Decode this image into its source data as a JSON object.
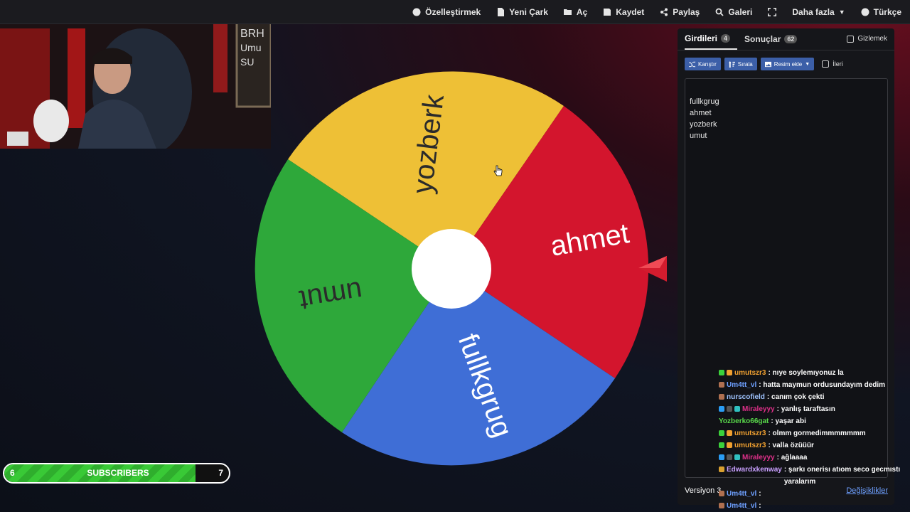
{
  "nav": {
    "customize": "Özelleştirmek",
    "new_wheel": "Yeni Çark",
    "open": "Aç",
    "save": "Kaydet",
    "share": "Paylaş",
    "gallery": "Galeri",
    "more": "Daha fazla",
    "language": "Türkçe"
  },
  "wheel": {
    "segments": [
      {
        "label": "yozberk",
        "color": "#eec036"
      },
      {
        "label": "ahmet",
        "color": "#d3152d"
      },
      {
        "label": "fullkgrug",
        "color": "#3f6ed6"
      },
      {
        "label": "umut",
        "color": "#2ea83a"
      }
    ]
  },
  "panel": {
    "tab_entries": "Girdileri",
    "entries_count": "4",
    "tab_results": "Sonuçlar",
    "results_count": "62",
    "hide": "Gizlemek",
    "shuffle": "Karıştır",
    "sort": "Sırala",
    "add_image": "Resim ekle",
    "advanced": "İleri",
    "entries": [
      "fullkgrug",
      "ahmet",
      "yozberk",
      "umut"
    ],
    "version": "Versiyon 3",
    "changes": "Değişiklikler"
  },
  "chat": [
    {
      "user": "umutszr3",
      "color": "#f0a030",
      "msg": ": nıye soylemıyonuz la",
      "badges": [
        "#3bd13b",
        "#f0a030"
      ]
    },
    {
      "user": "Um4tt_vl",
      "color": "#6ea0ff",
      "msg": ": hatta maymun ordusundayım dedim",
      "badges": [
        "#b07050"
      ]
    },
    {
      "user": "nurscofield",
      "color": "#a0c4ff",
      "msg": ": canım çok çekti",
      "badges": [
        "#b07050"
      ]
    },
    {
      "user": "Miraleyyy",
      "color": "#e0308a",
      "msg": ": yanlış taraftasın",
      "badges": [
        "#2a9df4",
        "#555",
        "#30c0c0"
      ]
    },
    {
      "user": "Yozberko66gat",
      "color": "#59d94b",
      "msg": ": yaşar abi",
      "badges": []
    },
    {
      "user": "umutszr3",
      "color": "#f0a030",
      "msg": ": olmm gormedimmmmmmm",
      "badges": [
        "#3bd13b",
        "#f0a030"
      ]
    },
    {
      "user": "umutszr3",
      "color": "#f0a030",
      "msg": ": valla özüüür",
      "badges": [
        "#3bd13b",
        "#f0a030"
      ]
    },
    {
      "user": "Miraleyyy",
      "color": "#e0308a",
      "msg": ": ağlaaaa",
      "badges": [
        "#2a9df4",
        "#555",
        "#30c0c0"
      ]
    },
    {
      "user": "Edwardxkenway",
      "color": "#c9a0ff",
      "msg": ": şarkı onerisı atıom seco gecmıstı yaralarım",
      "badges": [
        "#d9a030"
      ]
    },
    {
      "user": "Um4tt_vl",
      "color": "#6ea0ff",
      "msg": ":",
      "badges": [
        "#b07050"
      ]
    },
    {
      "user": "Um4tt_vl",
      "color": "#6ea0ff",
      "msg": ":",
      "badges": [
        "#b07050"
      ]
    }
  ],
  "subscribers": {
    "current": "6",
    "goal": "7",
    "label": "SUBSCRIBERS",
    "progress": 0.85
  }
}
